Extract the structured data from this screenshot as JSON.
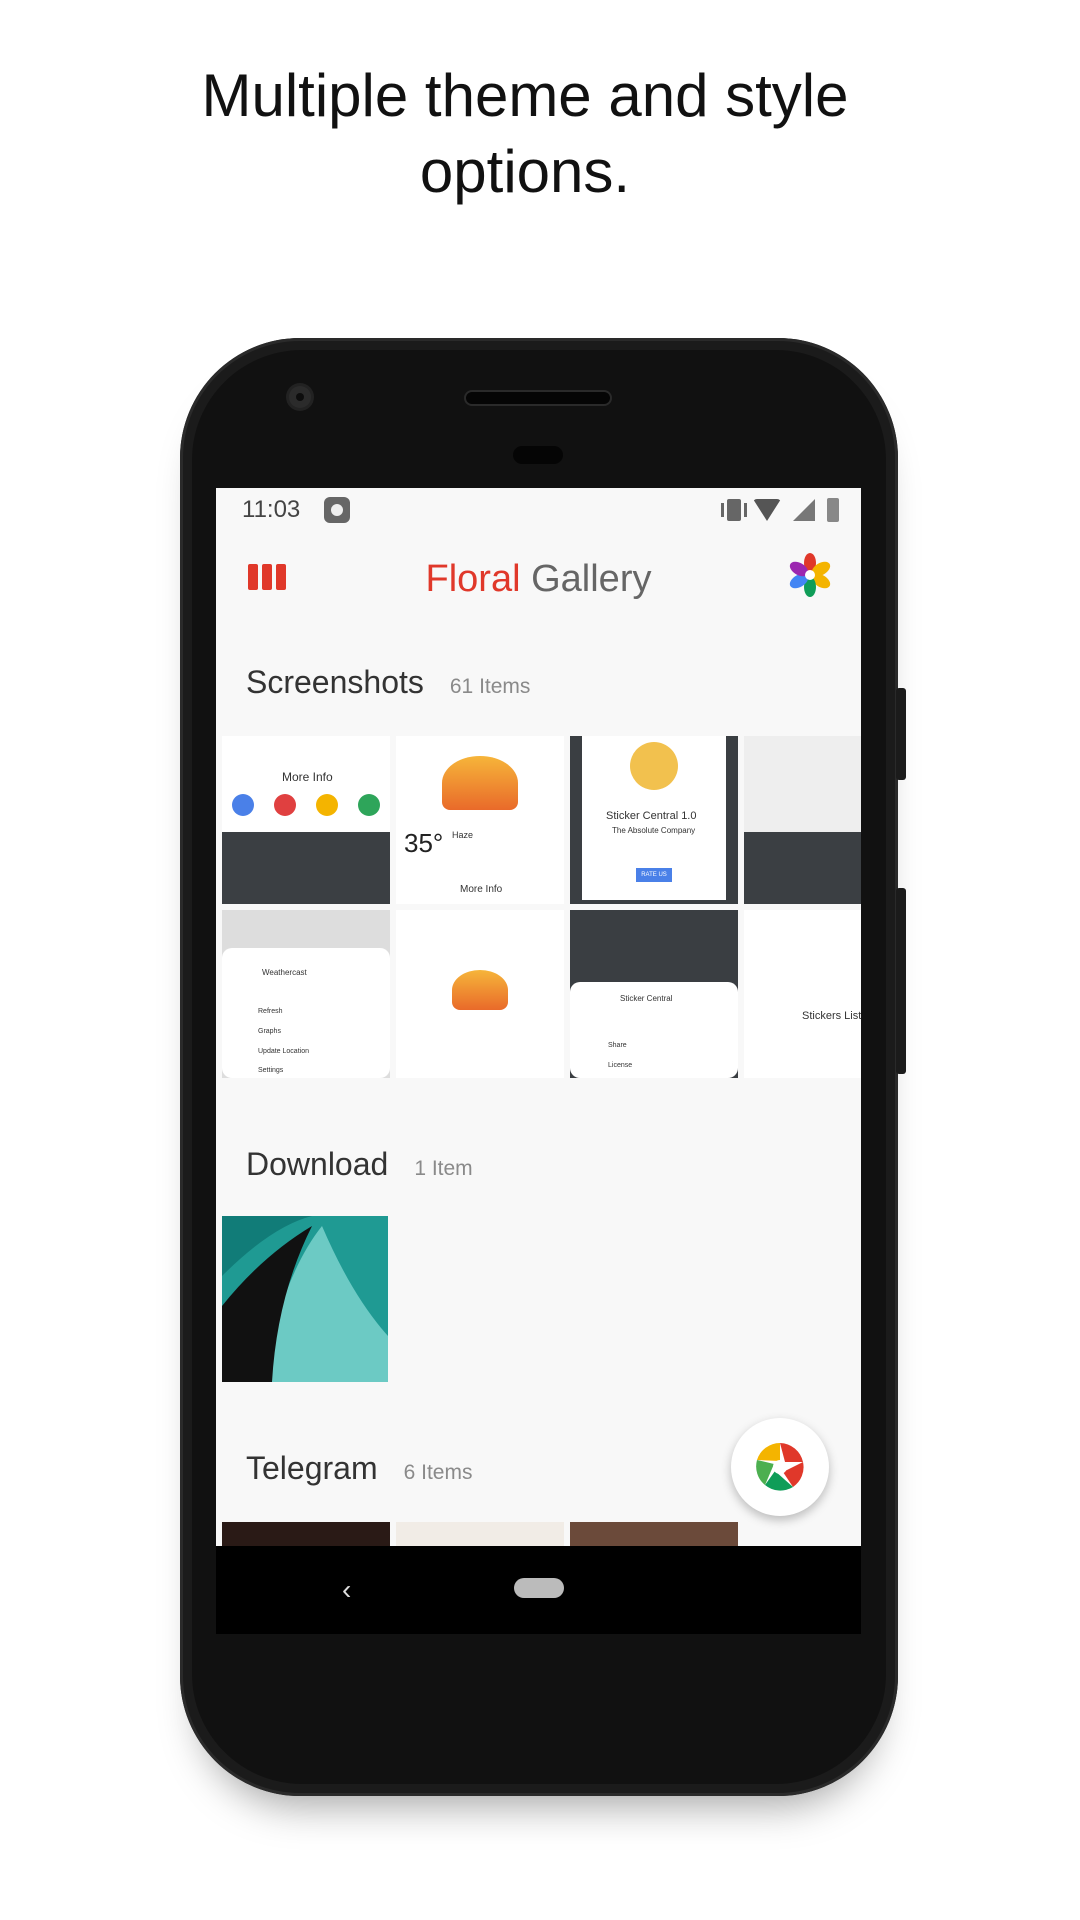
{
  "headline": {
    "line1": "Multiple theme and style",
    "line2": "options."
  },
  "status_bar": {
    "time": "11:03"
  },
  "app_bar": {
    "title_part1": "Floral",
    "title_part2": "Gallery"
  },
  "sections": [
    {
      "title": "Screenshots",
      "count": "61 Items"
    },
    {
      "title": "Download",
      "count": "1 Item"
    },
    {
      "title": "Telegram",
      "count": "6 Items"
    }
  ],
  "thumb_texts": {
    "more_info": "More Info",
    "temp": "35°",
    "haze": "Haze",
    "more_info_2": "More Info",
    "sticker_central": "Sticker Central 1.0",
    "absolute_company": "The Absolute Company",
    "rate_us": "RATE US",
    "weathercast": "Weathercast",
    "refresh": "Refresh",
    "graphs": "Graphs",
    "update_location": "Update Location",
    "settings": "Settings",
    "sticker_central_2": "Sticker Central",
    "share": "Share",
    "license": "License",
    "stickers_list": "Stickers List"
  },
  "colors": {
    "accent": "#e0382a",
    "background": "#f8f8f8",
    "teal": "#5fc2bd"
  }
}
